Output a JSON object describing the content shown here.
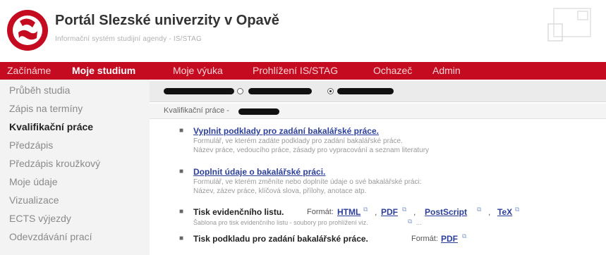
{
  "header": {
    "title": "Portál Slezské univerzity v Opavě",
    "subtitle": "Informační systém studijní agendy - IS/STAG",
    "logo_color": "#c40b20"
  },
  "menu": {
    "items": [
      "Začínáme",
      "Moje studium",
      "Moje výuka",
      "Prohlížení IS/STAG",
      "Ochazeč",
      "Admin"
    ],
    "active": "Moje studium",
    "color": "#c40b20"
  },
  "sidebar": {
    "items": [
      "Průběh studia",
      "Zápis na termíny",
      "Kvalifikační práce",
      "Předzápis",
      "Předzápis kroužkový",
      "Moje údaje",
      "Vizualizace",
      "ECTS výjezdy",
      "Odevzdávání prací"
    ],
    "active": "Kvalifikační práce"
  },
  "main": {
    "breadcrumb_label": "Kvalifikační práce -",
    "items": [
      {
        "link": "Vyplnit podklady pro zadání bakalářské práce.",
        "lines": [
          "Formulář, ve kterém zadáte podklady pro zadání bakalářské práce.",
          "Název práce, vedoucího práce, zásady pro vypracování a seznam literatury"
        ]
      },
      {
        "link": "Doplnit údaje o bakalářské práci.",
        "lines": [
          "Formulář, ve kterém změníte nebo doplníte údaje o své bakalářské práci:",
          "Název, zázev práce, klíčová slova, přílohy, anotace atp."
        ]
      }
    ],
    "print_sheet": {
      "label": "Tisk evidenčního listu.",
      "format_label": "Formát:",
      "formats": [
        "HTML",
        "PDF",
        "PostScript",
        "TeX"
      ],
      "desc": "Šablona pro tisk evidenčního listu - soubory pro prohlížení viz."
    },
    "print_assignment": {
      "label": "Tisk podkladu pro zadání bakalářské práce.",
      "format_label": "Formát:",
      "formats": [
        "PDF"
      ]
    }
  }
}
